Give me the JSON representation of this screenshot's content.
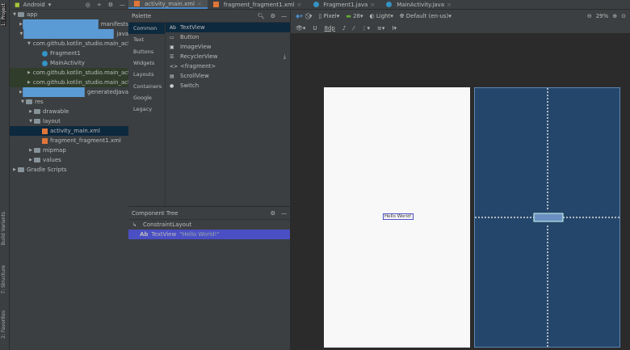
{
  "side_strip": {
    "top": "1: Project",
    "bottom": [
      "Build Variants",
      "7: Structure",
      "2: Favorites"
    ]
  },
  "project": {
    "view": "Android",
    "tree": [
      {
        "label": "app",
        "depth": 0,
        "icon": "folder",
        "open": true
      },
      {
        "label": "manifests",
        "depth": 1,
        "icon": "folder-blue"
      },
      {
        "label": "java",
        "depth": 1,
        "icon": "folder-blue",
        "open": true
      },
      {
        "label": "com.github.kotlin_studio.main_activity",
        "depth": 2,
        "icon": "package",
        "open": true
      },
      {
        "label": "Fragment1",
        "depth": 3,
        "icon": "class"
      },
      {
        "label": "MainActivity",
        "depth": 3,
        "icon": "class"
      },
      {
        "label": "com.github.kotlin_studio.main_activity",
        "depth": 2,
        "icon": "package",
        "state": "test"
      },
      {
        "label": "com.github.kotlin_studio.main_activity",
        "depth": 2,
        "icon": "package",
        "state": "test"
      },
      {
        "label": "generatedJava",
        "depth": 1,
        "icon": "folder-blue"
      },
      {
        "label": "res",
        "depth": 1,
        "icon": "folder",
        "open": true
      },
      {
        "label": "drawable",
        "depth": 2,
        "icon": "folder"
      },
      {
        "label": "layout",
        "depth": 2,
        "icon": "folder",
        "open": true
      },
      {
        "label": "activity_main.xml",
        "depth": 3,
        "icon": "xml",
        "selected": true
      },
      {
        "label": "fragment_fragment1.xml",
        "depth": 3,
        "icon": "xml"
      },
      {
        "label": "mipmap",
        "depth": 2,
        "icon": "folder"
      },
      {
        "label": "values",
        "depth": 2,
        "icon": "folder"
      },
      {
        "label": "Gradle Scripts",
        "depth": 0,
        "icon": "gradle"
      }
    ]
  },
  "tabs": [
    {
      "label": "activity_main.xml",
      "active": true
    },
    {
      "label": "fragment_fragment1.xml"
    },
    {
      "label": "Fragment1.java"
    },
    {
      "label": "MainActivity.java"
    }
  ],
  "palette": {
    "title": "Palette",
    "categories": [
      "Common",
      "Text",
      "Buttons",
      "Widgets",
      "Layouts",
      "Containers",
      "Google",
      "Legacy"
    ],
    "items": [
      {
        "icon": "Ab",
        "label": "TextView"
      },
      {
        "icon": "▭",
        "label": "Button"
      },
      {
        "icon": "▣",
        "label": "ImageView"
      },
      {
        "icon": "☰",
        "label": "RecyclerView"
      },
      {
        "icon": "<>",
        "label": "<fragment>"
      },
      {
        "icon": "▤",
        "label": "ScrollView"
      },
      {
        "icon": "●",
        "label": "Switch"
      }
    ]
  },
  "component_tree": {
    "title": "Component Tree",
    "root": "ConstraintLayout",
    "child_icon": "Ab",
    "child": "TextView",
    "child_text": "\"Hello World!\""
  },
  "toolbar": {
    "device": "Pixel",
    "api": "28",
    "theme": "Light",
    "locale": "Default (en-us)",
    "zoom": "29%",
    "margin": "8dp"
  },
  "design": {
    "text": "Hello World!"
  },
  "colors": {
    "accent": "#4a88c7",
    "blueprint": "#25466b",
    "selection": "#4b4fc4"
  }
}
